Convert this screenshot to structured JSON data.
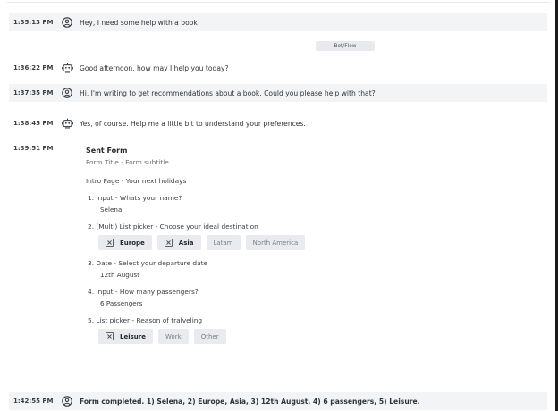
{
  "messages": [
    {
      "time": "1:35:13 PM",
      "sender": "user-icon",
      "text": "Hey, I need some help with a book"
    },
    {
      "time": "1:36:22 PM",
      "sender": "bot-icon",
      "text": "Good afternoon, how may I help you today?"
    },
    {
      "time": "1:37:35 PM",
      "sender": "user-icon",
      "text": "Hi, I'm writing to get recommendations about a book. Could you please help with that?"
    },
    {
      "time": "1:38:45 PM",
      "sender": "bot-icon",
      "text": "Yes, of course. Help me a little bit to understand your preferences."
    },
    {
      "time": "1:39:51 PM",
      "text": "Sent Form"
    },
    {
      "time": "1:42:55 PM",
      "sender": "user-icon",
      "text": "Form completed. 1) Selena, 2) Europe, Asia, 3) 12th August, 4) 6 passengers, 5) Leisure."
    }
  ],
  "divider_label": "Bot/Flow",
  "form": {
    "title": "Form Title - Form subtitle",
    "intro": "Intro Page - Your next holidays",
    "questions": [
      {
        "label": "1. Input - Whats your name?",
        "answer": "Selena"
      },
      {
        "label": "2. (Multi) List picker - Choose your ideal destination",
        "options": [
          {
            "label": "Europe",
            "selected": true
          },
          {
            "label": "Asia",
            "selected": true
          },
          {
            "label": "Latam",
            "selected": false
          },
          {
            "label": "North America",
            "selected": false
          }
        ]
      },
      {
        "label": "3.  Date - Select your departure date",
        "answer": "12th August"
      },
      {
        "label": "4. Input - How many passengers?",
        "answer": "6 Passengers"
      },
      {
        "label": "5. List picker - Reason of tralveling",
        "options": [
          {
            "label": "Leisure",
            "selected": true
          },
          {
            "label": "Work",
            "selected": false
          },
          {
            "label": "Other",
            "selected": false
          }
        ]
      }
    ]
  },
  "colors": {
    "row_shade": "#f2f4f6",
    "chip_bg": "#e9ebee",
    "text": "#2b2f33"
  }
}
